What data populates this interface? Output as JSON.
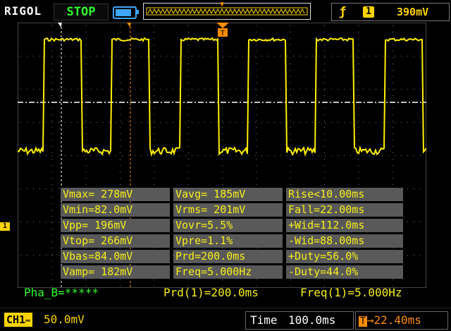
{
  "header": {
    "brand": "RIGOL",
    "run_state": "STOP",
    "trigger": {
      "edge_symbol": "ƒ",
      "channel": "1",
      "level": "390mV"
    }
  },
  "colors": {
    "trace": "#ffee00",
    "run_state": "#2cff2c",
    "measure_bg": "#595959",
    "measure_text": "#f7ef1a",
    "offset": "#ff8c00",
    "battery": "#3ea6ff"
  },
  "measurements": {
    "rows": [
      [
        "Vmax= 278mV",
        "Vavg= 185mV",
        "Rise<10.00ms"
      ],
      [
        "Vmin=82.0mV",
        "Vrms= 201mV",
        "Fall=22.00ms"
      ],
      [
        "Vpp= 196mV",
        "Vovr=5.5%",
        "+Wid=112.0ms"
      ],
      [
        "Vtop= 266mV",
        "Vpre=1.1%",
        "-Wid=88.00ms"
      ],
      [
        "Vbas=84.0mV",
        "Prd=200.0ms",
        "+Duty=56.0%"
      ],
      [
        "Vamp= 182mV",
        "Freq=5.000Hz",
        "-Duty=44.0%"
      ]
    ]
  },
  "info_line": {
    "phase": "Pha_B=*****",
    "period": "Prd(1)=200.0ms",
    "frequency": "Freq(1)=5.000Hz"
  },
  "status_bar": {
    "channel": "CH1",
    "volts_per_div": "50.0mV",
    "time_label": "Time",
    "time_per_div": "100.0ms",
    "offset": "22.40ms"
  },
  "markers": {
    "channel_marker": "1",
    "trigger_marker": "T"
  },
  "waveform": {
    "type": "square",
    "period_ms": 200,
    "duty_percent": 56,
    "v_high_mV": 266,
    "v_low_mV": 84,
    "trigger_level_mV": 390,
    "time_per_div_ms": 100,
    "volts_per_div_mV": 50
  }
}
